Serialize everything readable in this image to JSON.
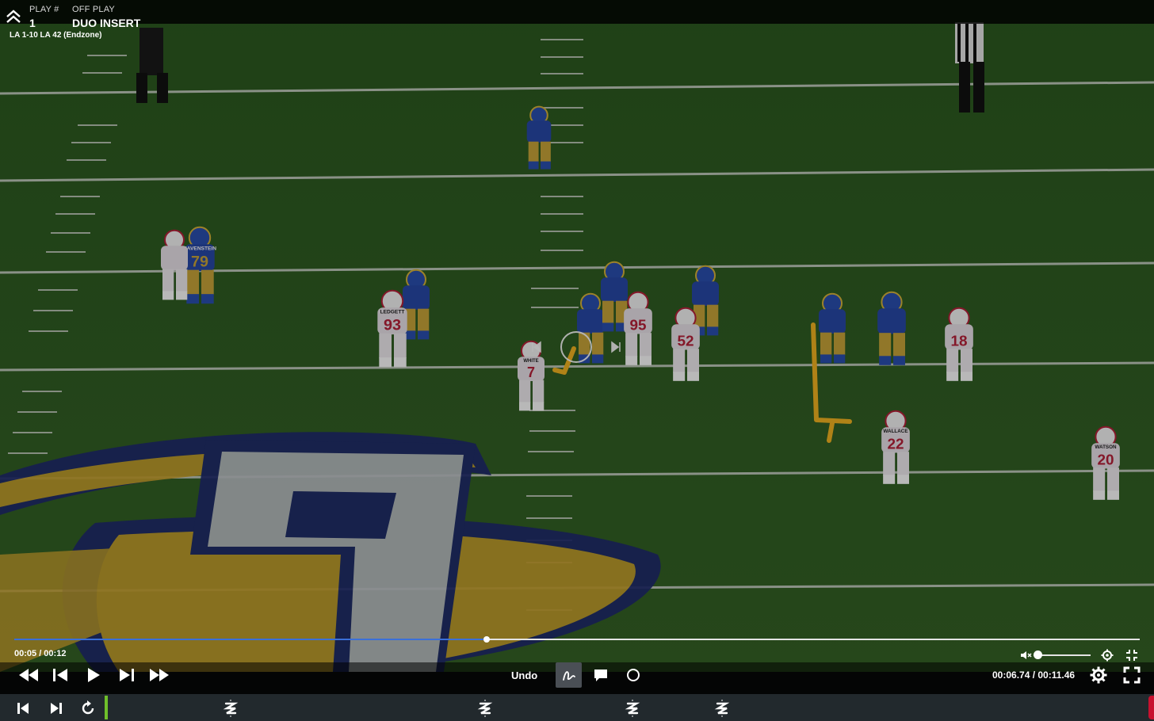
{
  "header": {
    "play_num_label": "PLAY #",
    "play_num": "1",
    "off_play_label": "OFF PLAY",
    "off_play": "DUO INSERT",
    "situation": "LA  1-10  LA 42 (Endzone)"
  },
  "field": {
    "jersey_numbers": [
      "79",
      "93",
      "7",
      "95",
      "52",
      "22",
      "18",
      "20"
    ],
    "nameplates": [
      "HAVENSTEIN",
      "LEDGETT",
      "WHITE",
      "WALLACE",
      "WATSON"
    ]
  },
  "player": {
    "elapsed": "00:05 / 00:12",
    "progress_fraction": 0.42,
    "undo_label": "Undo",
    "timecode": "00:06.74 / 00:11.46",
    "volume_fraction": 0.0
  },
  "icons": {
    "collapse": "chevron-double-up-icon",
    "rewind": "rewind-icon",
    "step_back": "step-back-icon",
    "play": "play-icon",
    "step_forward": "step-forward-icon",
    "fast_forward": "fast-forward-icon",
    "draw": "freehand-draw-icon",
    "comment": "comment-icon",
    "circle": "circle-shape-icon",
    "mute": "mute-icon",
    "settings": "gear-icon",
    "fullscreen": "fullscreen-icon",
    "skip_start": "skip-start-icon",
    "skip_end": "skip-end-icon",
    "replay": "replay-icon"
  },
  "colors": {
    "telestration": "#f4b421",
    "timeline_fill": "#3a6fd8",
    "strip_start": "#6fbf2a",
    "strip_end": "#c8102e",
    "home_jersey": "#2848a8",
    "home_pants": "#c9a63a",
    "away_jersey": "#eae4ea",
    "away_trim": "#b8203a",
    "turf": "#2f5a22"
  }
}
